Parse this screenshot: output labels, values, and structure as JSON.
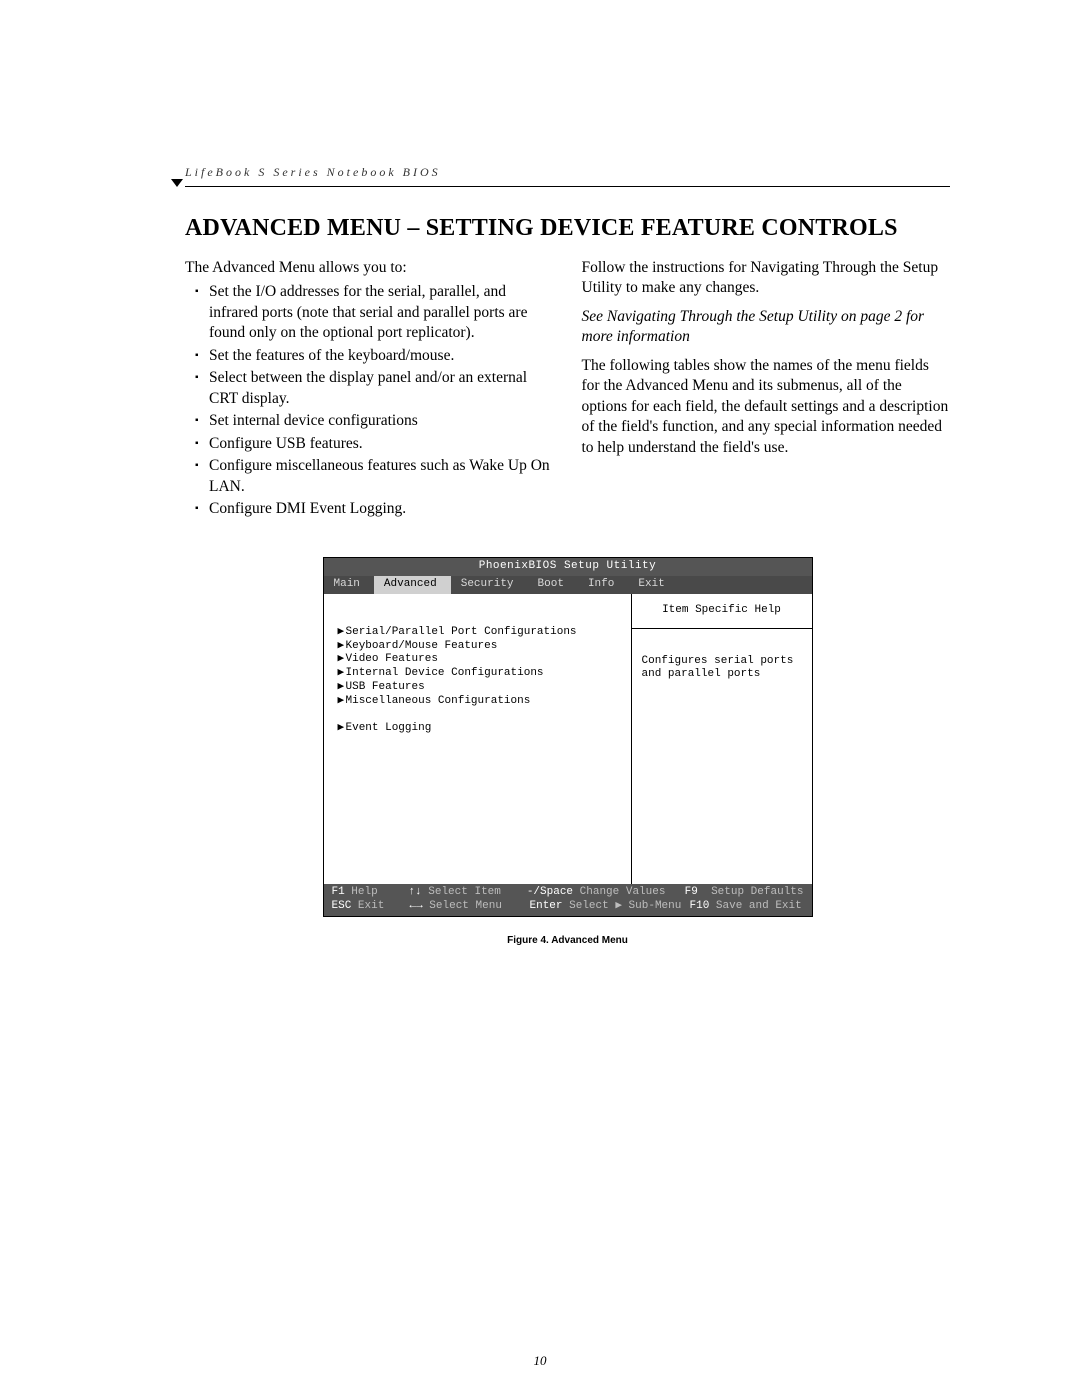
{
  "header": {
    "running_head": "LifeBook S Series Notebook BIOS"
  },
  "title": "ADVANCED MENU – SETTING DEVICE FEATURE CONTROLS",
  "left_col": {
    "intro": "The Advanced Menu allows you to:",
    "bullets": [
      "Set the I/O addresses for the serial, parallel, and infrared ports (note that serial and parallel ports are found only on the optional port replicator).",
      "Set the features of the keyboard/mouse.",
      "Select between the display panel and/or an external CRT display.",
      "Set internal device configurations",
      "Configure USB features.",
      "Configure miscellaneous features such as Wake Up On LAN.",
      "Configure DMI Event Logging."
    ]
  },
  "right_col": {
    "p1": "Follow the instructions for Navigating Through the Setup Utility to make any changes.",
    "xref": "See Navigating Through the Setup Utility on page 2 for more information",
    "p2": "The following tables show the names of the menu fields for the Advanced Menu and its submenus, all of the options for each field, the default settings and a description of the field's function, and any special information needed to help understand the field's use."
  },
  "bios": {
    "title": "PhoenixBIOS Setup Utility",
    "tabs": [
      "Main",
      "Advanced",
      "Security",
      "Boot",
      "Info",
      "Exit"
    ],
    "active_tab": "Advanced",
    "items": [
      "Serial/Parallel Port Configurations",
      "Keyboard/Mouse Features",
      "Video Features",
      "Internal Device Configurations",
      "USB Features",
      "Miscellaneous Configurations",
      "",
      "Event Logging"
    ],
    "help_title": "Item Specific Help",
    "help_body": "Configures serial ports and parallel ports",
    "foot": {
      "r1": {
        "k1": "F1",
        "l1": " Help",
        "k2": "↑↓",
        "l2": " Select Item",
        "k3": "-/Space",
        "l3": " Change Values",
        "k4": "F9",
        "l4": "  Setup Defaults"
      },
      "r2": {
        "k1": "ESC",
        "l1": " Exit",
        "k2": "←→",
        "l2": " Select Menu",
        "k3": "Enter",
        "l3": " Select ▶ Sub-Menu",
        "k4": "F10",
        "l4": " Save and Exit"
      }
    }
  },
  "caption": "Figure 4.   Advanced Menu",
  "page_number": "10"
}
